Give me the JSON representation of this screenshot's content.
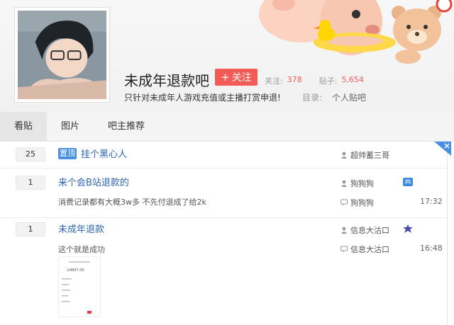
{
  "forum": {
    "name": "未成年退款吧",
    "follow_label": "关注",
    "stats": {
      "follow_label": "关注:",
      "follow_count": "378",
      "post_label": "贴子:",
      "post_count": "5,654"
    },
    "slogan": "只针对未成年人游戏充值或主播打赏申退!",
    "catalog_label": "目录:",
    "catalog_value": "个人贴吧"
  },
  "tabs": [
    {
      "label": "看贴",
      "active": true
    },
    {
      "label": "图片",
      "active": false
    },
    {
      "label": "吧主推荐",
      "active": false
    }
  ],
  "threads": [
    {
      "reply_count": "25",
      "badge": "置顶",
      "title": "挂个黑心人",
      "author": "超帅蓄三哥"
    },
    {
      "reply_count": "1",
      "title": "来个会B站退款的",
      "author": "狗狗狗",
      "abstract": "消费记录都有大概3w多 不先付退成了给2k",
      "last_reply": "狗狗狗",
      "time": "17:32"
    },
    {
      "reply_count": "1",
      "title": "未成年退款",
      "author": "信息大沽口",
      "abstract": "这个就是成功",
      "last_reply": "信息大沽口",
      "time": "16:48",
      "thumb_amount": "-24897.00"
    }
  ],
  "colors": {
    "accent": "#f35b57",
    "link": "#2d64b3",
    "badge": "#4a90e2"
  }
}
